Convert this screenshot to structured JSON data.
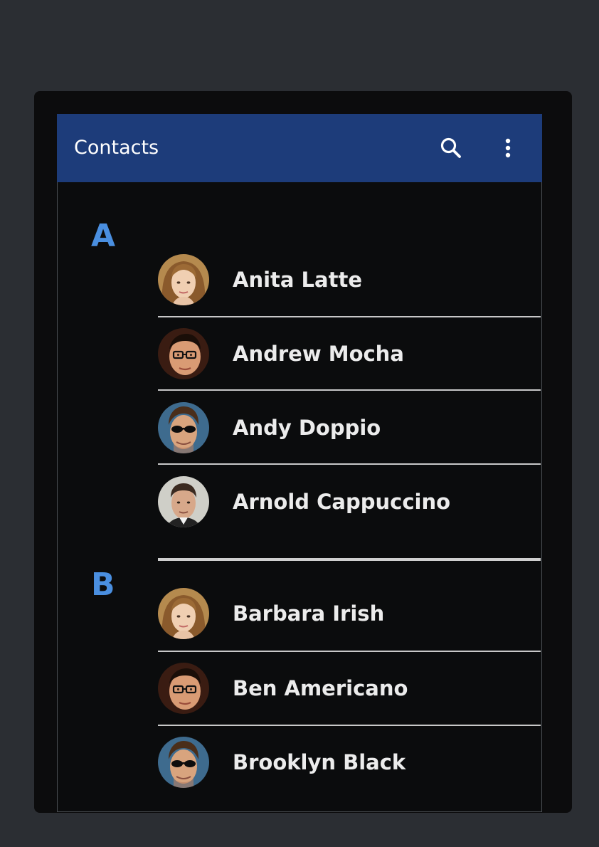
{
  "appbar": {
    "title": "Contacts",
    "search_icon": "search-icon",
    "more_icon": "more-vertical-icon",
    "color": "#1d3c7a"
  },
  "colors": {
    "accent_letter": "#4a8fe0",
    "background": "#0b0c0d",
    "divider": "#c8c8c8"
  },
  "sections": [
    {
      "letter": "A",
      "contacts": [
        {
          "name": "Anita Latte",
          "avatar": "woman-avatar"
        },
        {
          "name": "Andrew Mocha",
          "avatar": "man-glasses-avatar"
        },
        {
          "name": "Andy Doppio",
          "avatar": "man-sunglasses-avatar"
        },
        {
          "name": "Arnold Cappuccino",
          "avatar": "man-avatar"
        }
      ]
    },
    {
      "letter": "B",
      "contacts": [
        {
          "name": "Barbara Irish",
          "avatar": "woman-avatar"
        },
        {
          "name": "Ben Americano",
          "avatar": "man-glasses-avatar"
        },
        {
          "name": "Brooklyn Black",
          "avatar": "man-sunglasses-avatar"
        }
      ]
    }
  ]
}
